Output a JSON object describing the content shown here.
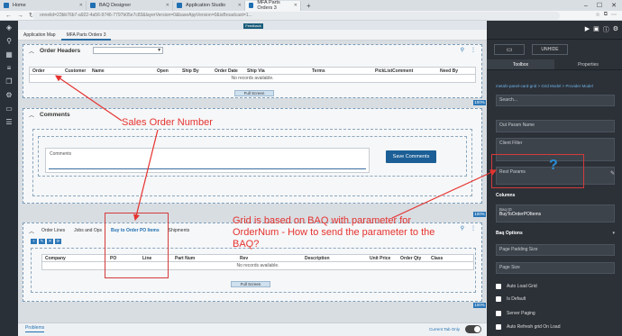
{
  "browser": {
    "tabs": [
      {
        "label": "Home"
      },
      {
        "label": "BAQ Designer"
      },
      {
        "label": "Application Studio"
      },
      {
        "label": "MFA Parts Orders 3",
        "active": true
      }
    ],
    "url": "onnelid=23bb76b7-a922-4a56-9746-7797b05e7c83&layerVersion=0&baseAppVersion=0&isBroadcast=1..."
  },
  "feedback_label": "Feedback",
  "app_tabs": [
    "Application Map",
    "MFA Parts Orders 3"
  ],
  "order_headers": {
    "title": "Order Headers",
    "columns": [
      "Order",
      "Customer",
      "Name",
      "Open",
      "Ship By",
      "Order Date",
      "Ship Via",
      "Terms",
      "PickListComment",
      "Need By"
    ],
    "empty_message": "No records available.",
    "fullscreen_label": "Full Screen",
    "percent": "100%"
  },
  "comments": {
    "title": "Comments",
    "field_label": "Comments",
    "save_label": "Save Comments",
    "percent": "100%"
  },
  "lines": {
    "tabs": [
      "Order Lines",
      "Jobs and Ops",
      "Buy to Order PO Items",
      "Shipments"
    ],
    "active_tab": 2,
    "columns": [
      "Company",
      "PO",
      "Line",
      "Part Num",
      "Rev",
      "Description",
      "Unit Price",
      "Order Qty",
      "Class"
    ],
    "empty_message": "No records available.",
    "fullscreen_label": "Full Screen",
    "percent": "100%",
    "tool_buttons": [
      "+",
      "✎",
      "✕",
      "⟳"
    ]
  },
  "bottom": {
    "problems_label": "Problems",
    "current_tab_label": "Current Tab Only"
  },
  "right_panel": {
    "unhide_label": "UNHIDE",
    "tabs": [
      "Toolbox",
      "Properties"
    ],
    "breadcrumb": "metafx-panel-card-grid > Grid Model > Provider Model",
    "search_placeholder": "Search...",
    "out_param_name": "Out Param Name",
    "client_filter": "Client Filter",
    "rest_params": "Rest Params",
    "columns_label": "Columns",
    "baq_id_label": "Baq ID",
    "baq_id_value": "BuyToOrderPOItems",
    "baq_options": "Baq Options",
    "page_padding": "Page Padding Size",
    "page_size": "Page Size",
    "checkboxes": [
      "Auto Load Grid",
      "Is Default",
      "Server Paging",
      "Auto Refresh grid On Load"
    ]
  },
  "annotations": {
    "sales_order": "Sales Order Number",
    "grid_note": "Grid is based on BAQ with parameter for OrderNum - How to send the parameter to the BAQ?",
    "question": "?"
  }
}
